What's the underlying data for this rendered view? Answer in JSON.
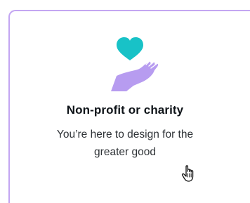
{
  "card": {
    "title": "Non-profit or charity",
    "description": "You’re here to design for the greater good",
    "icon": "heart-in-hand-icon",
    "selected": true
  },
  "colors": {
    "border": "#c3a6f2",
    "heart": "#18c2c7",
    "hand": "#b79cf0",
    "title": "#0e1318",
    "text": "#2f3337"
  },
  "cursor": "hand-pointer-icon"
}
